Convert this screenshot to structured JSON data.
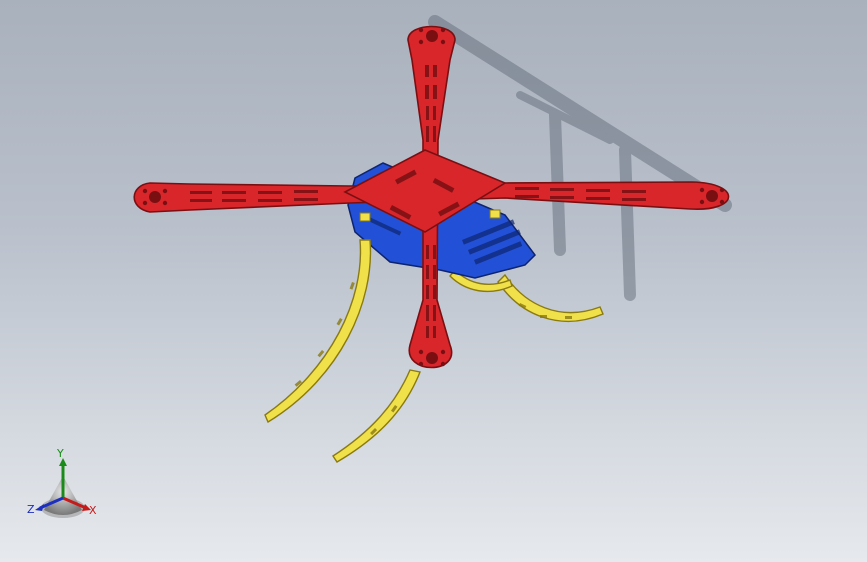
{
  "viewport": {
    "background_top": "#a9b1bd",
    "background_bottom": "#e6e9ed"
  },
  "model": {
    "frame_color": "#d8262b",
    "frame_edge_color": "#7a0f12",
    "plate_color": "#2250d6",
    "plate_edge_color": "#0d2470",
    "leg_color": "#f0e04a",
    "leg_edge_color": "#8a7a12",
    "shadow_color": "#5a6472"
  },
  "triad": {
    "x_label": "X",
    "y_label": "Y",
    "z_label": "Z",
    "x_color": "#c41b1b",
    "y_color": "#1a8a1a",
    "z_color": "#1d2fbf"
  }
}
